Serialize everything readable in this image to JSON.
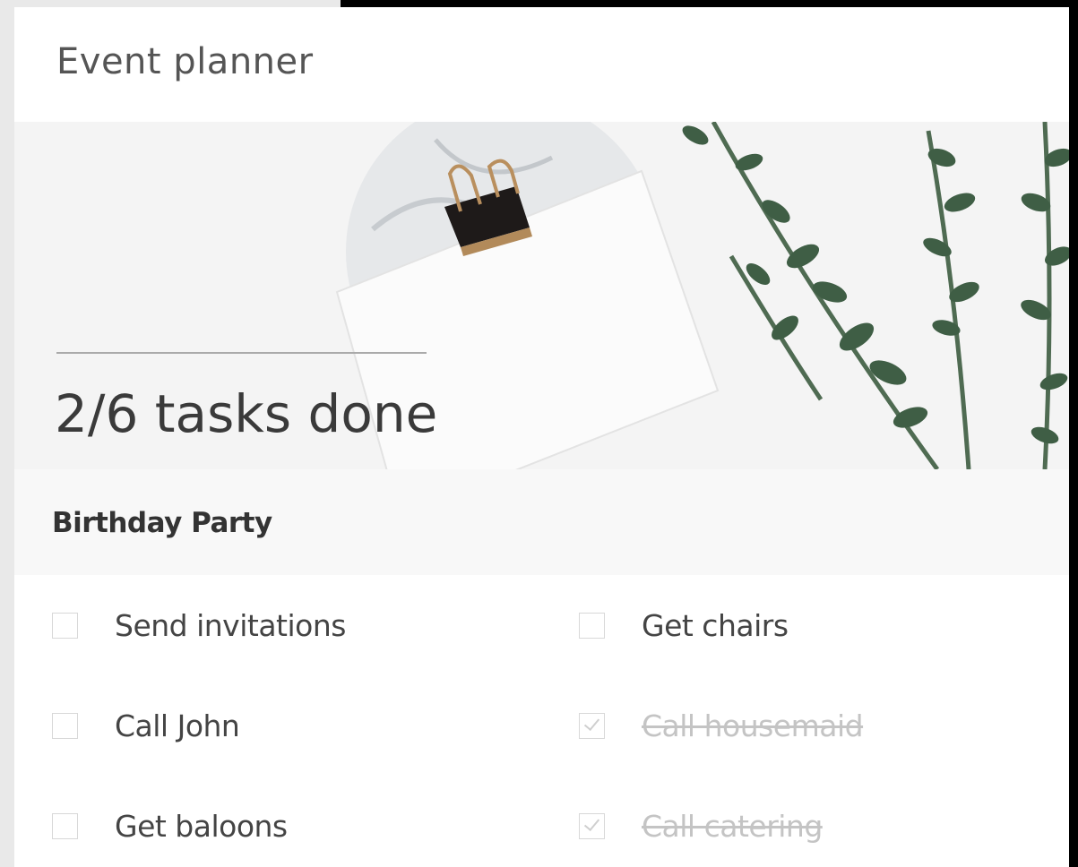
{
  "app": {
    "title": "Event planner"
  },
  "hero": {
    "progress_text": "2/6 tasks done",
    "done": 2,
    "total": 6
  },
  "section": {
    "title": "Birthday Party"
  },
  "tasks": [
    {
      "label": "Send invitations",
      "done": false
    },
    {
      "label": "Get chairs",
      "done": false
    },
    {
      "label": "Call John",
      "done": false
    },
    {
      "label": "Call housemaid",
      "done": true
    },
    {
      "label": "Get baloons",
      "done": false
    },
    {
      "label": "Call catering",
      "done": true
    }
  ],
  "colors": {
    "accent_text": "#3a3a3a",
    "done_text": "#c4c4c4",
    "leaf_green": "#3f5e45"
  }
}
